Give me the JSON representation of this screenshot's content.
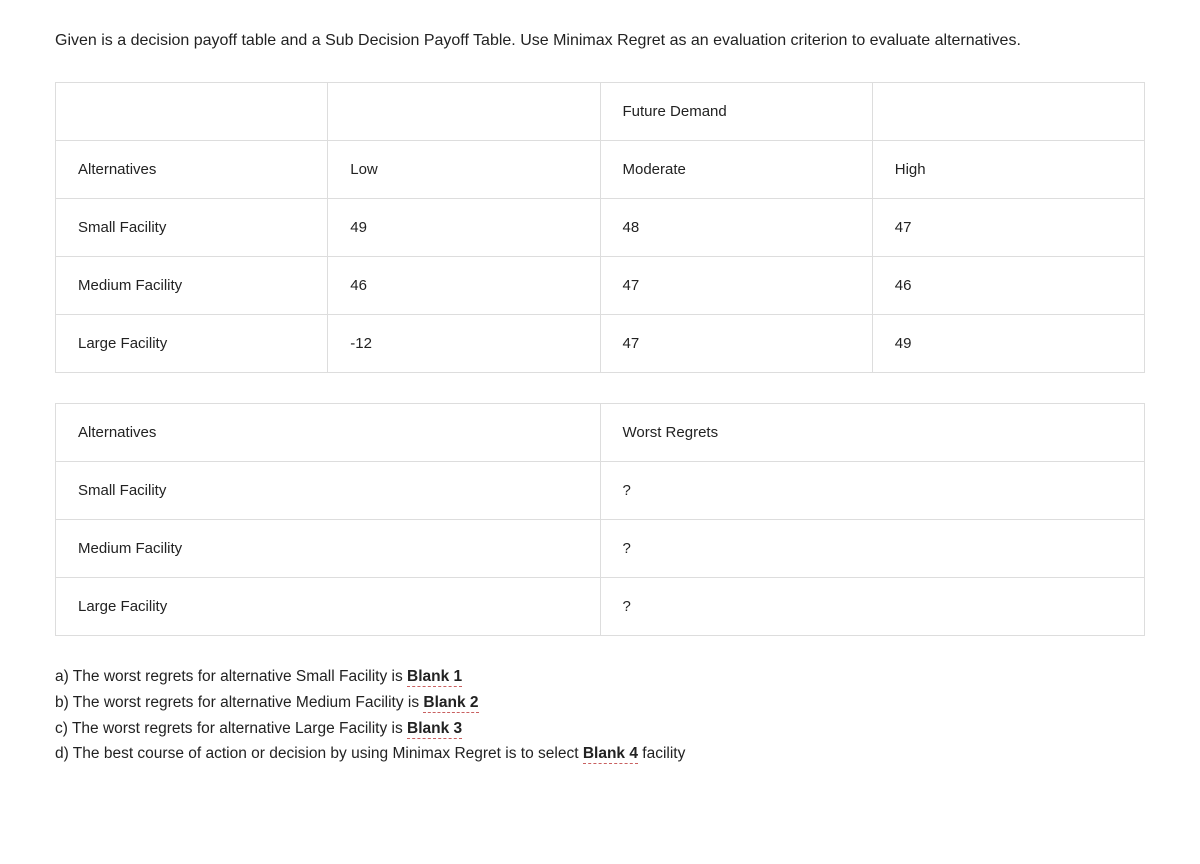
{
  "intro": "Given is a decision payoff table and a Sub Decision Payoff Table. Use Minimax Regret as an evaluation criterion to evaluate alternatives.",
  "payoff": {
    "header": {
      "blank1": "",
      "blank2": "",
      "future_demand": "Future Demand",
      "blank3": ""
    },
    "columns": {
      "alt": "Alternatives",
      "low": "Low",
      "moderate": "Moderate",
      "high": "High"
    },
    "rows": [
      {
        "alt": "Small Facility",
        "low": "49",
        "moderate": "48",
        "high": "47"
      },
      {
        "alt": "Medium Facility",
        "low": "46",
        "moderate": "47",
        "high": "46"
      },
      {
        "alt": "Large Facility",
        "low": "-12",
        "moderate": "47",
        "high": "49"
      }
    ]
  },
  "regret": {
    "columns": {
      "alt": "Alternatives",
      "worst": "Worst Regrets"
    },
    "rows": [
      {
        "alt": "Small Facility",
        "val": "?"
      },
      {
        "alt": "Medium Facility",
        "val": "?"
      },
      {
        "alt": "Large Facility",
        "val": "?"
      }
    ]
  },
  "answers": {
    "a_pre": "a) The worst regrets for alternative Small Facility is ",
    "a_blank": "Blank 1",
    "b_pre": "b) The worst regrets for alternative Medium Facility is ",
    "b_blank": "Blank 2",
    "c_pre": "c) The worst regrets for alternative Large Facility is ",
    "c_blank": "Blank 3",
    "d_pre": "d) The best course of action or decision by using Minimax Regret is to select ",
    "d_blank": "Blank 4",
    "d_post": " facility"
  }
}
